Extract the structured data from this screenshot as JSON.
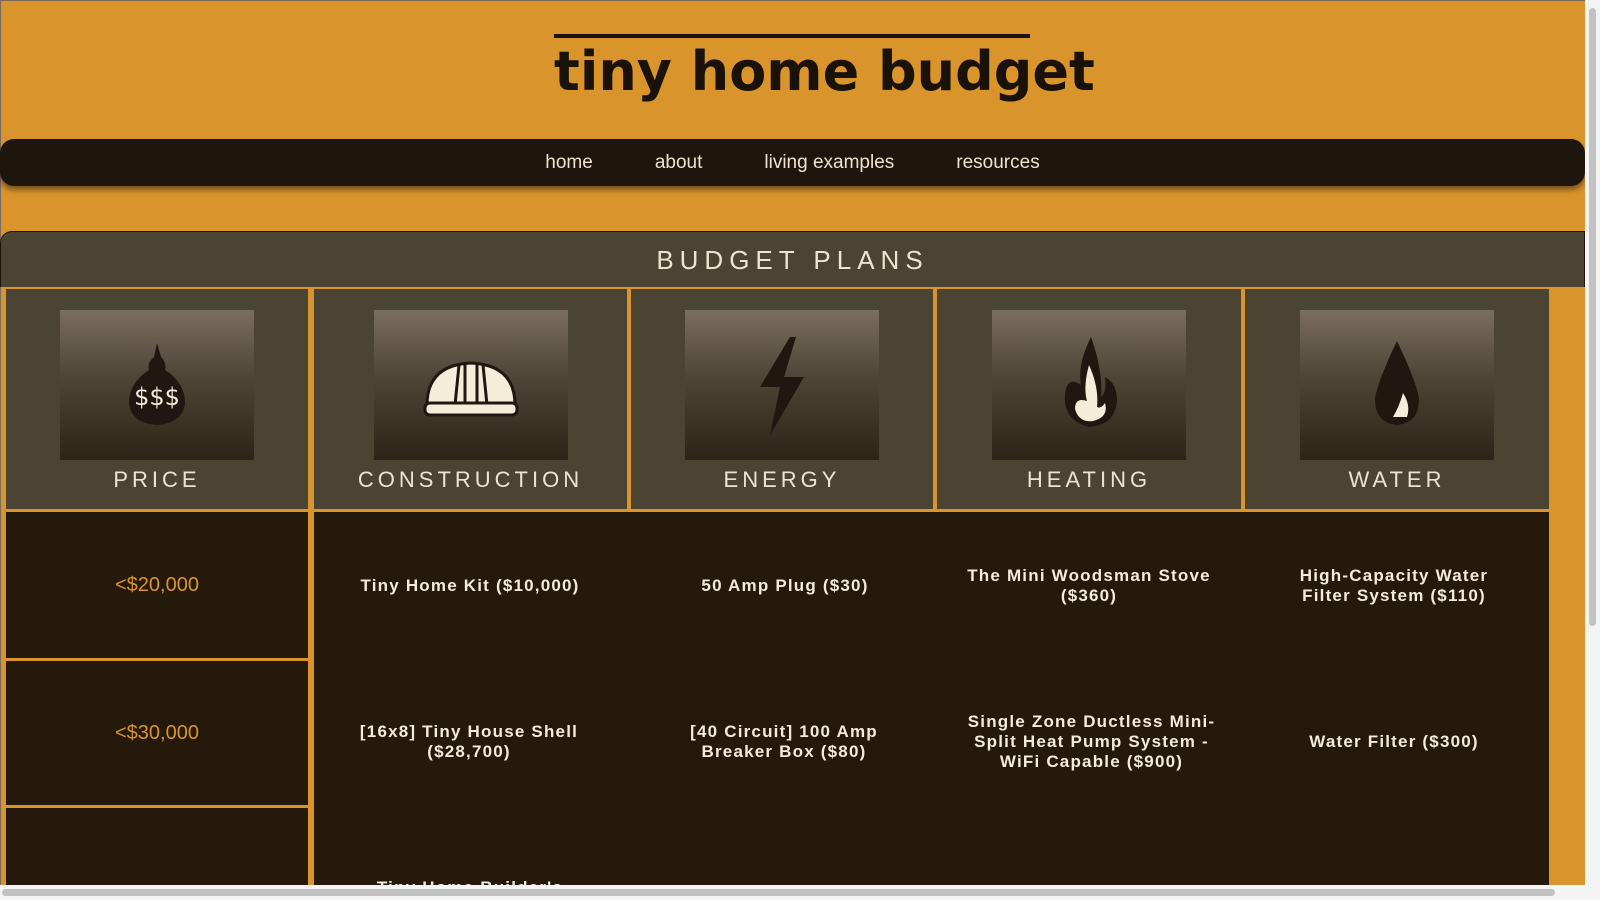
{
  "site": {
    "title": "tiny home budget"
  },
  "nav": {
    "items": [
      "home",
      "about",
      "living examples",
      "resources"
    ]
  },
  "section": {
    "title": "BUDGET PLANS"
  },
  "categories": [
    {
      "label": "PRICE",
      "icon": "money-bag-icon"
    },
    {
      "label": "CONSTRUCTION",
      "icon": "hard-hat-icon"
    },
    {
      "label": "ENERGY",
      "icon": "lightning-bolt-icon"
    },
    {
      "label": "HEATING",
      "icon": "flame-icon"
    },
    {
      "label": "WATER",
      "icon": "water-drop-icon"
    }
  ],
  "icon_symbol": "$$$",
  "rows": [
    {
      "price": "<$20,000",
      "construction": "Tiny Home Kit ($10,000)",
      "energy": "50 Amp Plug ($30)",
      "heating": "The Mini Woodsman Stove ($360)",
      "water": "High-Capacity Water Filter System ($110)"
    },
    {
      "price": "<$30,000",
      "construction": "[16x8] Tiny House Shell ($28,700)",
      "energy": "[40 Circuit] 100 Amp Breaker Box ($80)",
      "heating": "Single Zone Ductless Mini-Split Heat Pump System - WiFi Capable ($900)",
      "water": "Water Filter ($300)"
    },
    {
      "price": "",
      "construction": "Tiny Home Builder's",
      "energy": "",
      "heating": "",
      "water": ""
    }
  ],
  "colors": {
    "page": "#d9952b",
    "nav": "#1e160c",
    "panel": "#4b4433",
    "body": "#24190a",
    "accent": "#d9952b",
    "text": "#efe3cf"
  }
}
